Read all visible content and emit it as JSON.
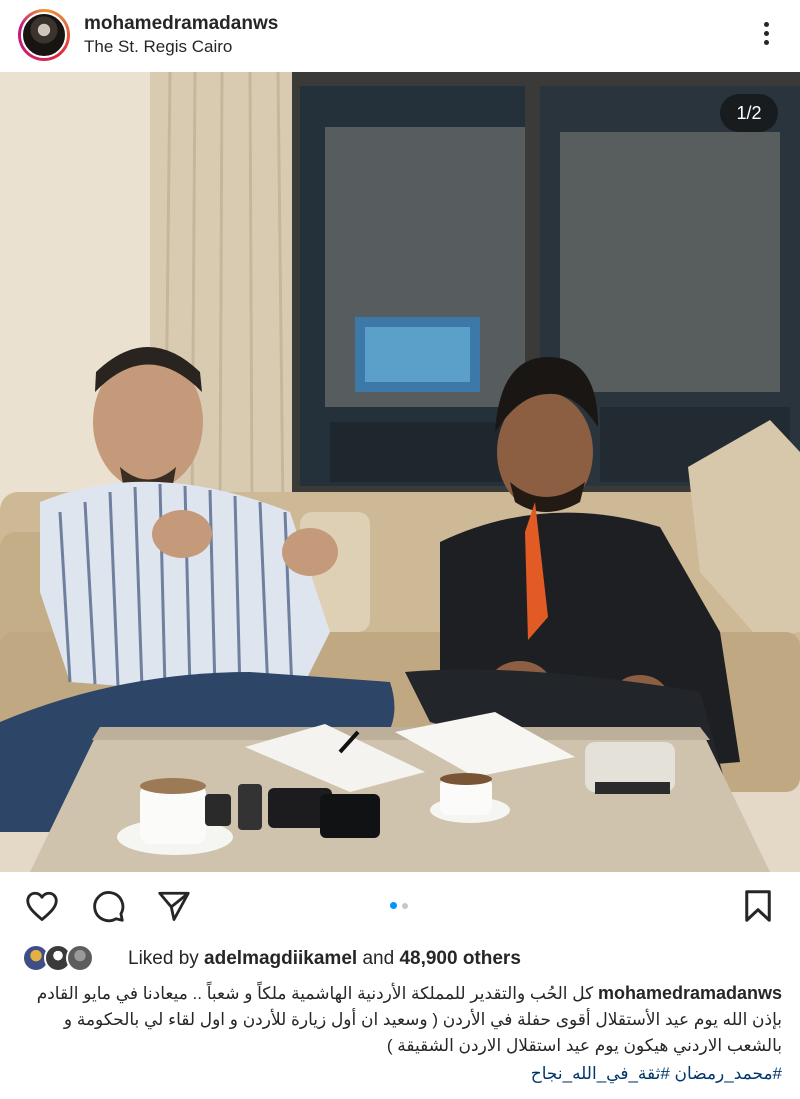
{
  "post": {
    "username": "mohamedramadanws",
    "location": "The St. Regis Cairo",
    "more_icon": "more-vertical-icon",
    "photo_counter": "1/2"
  },
  "actions": {
    "like_icon": "heart-icon",
    "comment_icon": "comment-icon",
    "share_icon": "send-icon",
    "save_icon": "bookmark-icon",
    "carousel_index": 0,
    "carousel_count": 2
  },
  "likes": {
    "prefix": "Liked by ",
    "liked_by_user": "adelmagdiikamel",
    "middle": " and ",
    "others": "48,900 others"
  },
  "caption": {
    "username": "mohamedramadanws",
    "text": "كل الحُب والتقدير للمملكة الأردنية الهاشمية ملكاً و شعباً .. ميعادنا في مايو القادم بإذن الله يوم عيد الأستقلال أقوى حفلة في الأردن ( وسعيد ان أول زيارة للأردن و اول لقاء لي بالحكومة و بالشعب الاردني هيكون يوم عيد استقلال الاردن الشقيقة )",
    "hashtags": "#محمد_رمضان #ثقة_في_الله_نجاح"
  },
  "colors": {
    "text": "#262626",
    "link": "#00376b",
    "carousel_active": "#0095f6",
    "carousel_inactive": "#c7c7c7"
  }
}
